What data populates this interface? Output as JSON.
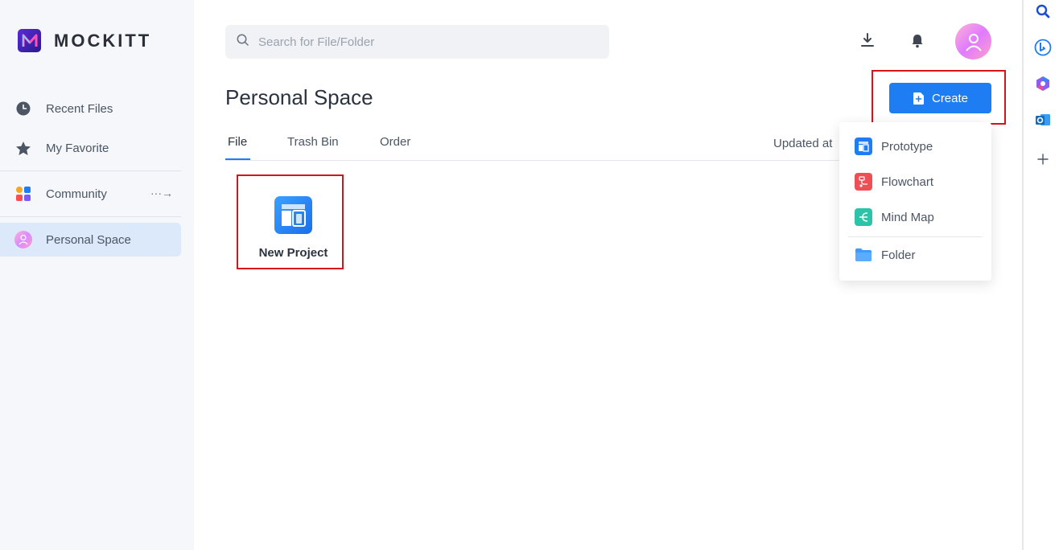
{
  "app": {
    "brand": "MOCKITT",
    "brand_color": "#5b2bd6",
    "accent": "#1e7df2"
  },
  "sidebar": {
    "items": [
      {
        "label": "Recent Files",
        "icon": "clock-icon"
      },
      {
        "label": "My Favorite",
        "icon": "star-icon"
      },
      {
        "label": "Community",
        "icon": "apps-icon"
      },
      {
        "label": "Personal Space",
        "icon": "avatar-icon",
        "active": true
      }
    ]
  },
  "search": {
    "placeholder": "Search for File/Folder",
    "value": ""
  },
  "header": {
    "icons": [
      "download-icon",
      "bell-icon",
      "user-avatar"
    ]
  },
  "main": {
    "title": "Personal Space",
    "create_label": "Create",
    "tabs": [
      {
        "label": "File",
        "active": true
      },
      {
        "label": "Trash Bin"
      },
      {
        "label": "Order"
      }
    ],
    "sort_label": "Updated at",
    "new_project_label": "New Project"
  },
  "create_menu": {
    "items": [
      {
        "label": "Prototype",
        "icon": "prototype-icon"
      },
      {
        "label": "Flowchart",
        "icon": "flowchart-icon"
      },
      {
        "label": "Mind Map",
        "icon": "mindmap-icon"
      },
      {
        "label": "Folder",
        "icon": "folder-icon"
      }
    ]
  },
  "browser_sidebar": {
    "icons": [
      "search-icon",
      "bing-icon",
      "copilot-icon",
      "outlook-icon",
      "add-icon"
    ]
  }
}
